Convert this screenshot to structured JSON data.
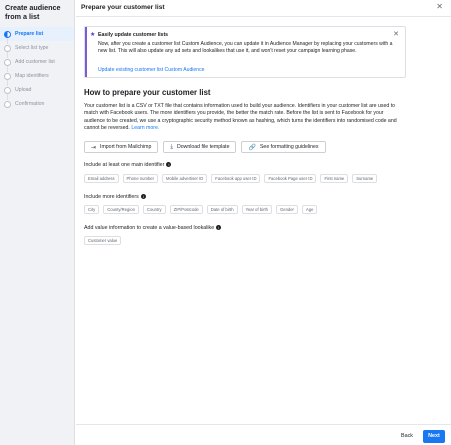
{
  "sidebar": {
    "title": "Create audience from a list",
    "steps": [
      {
        "label": "Prepare list",
        "active": true
      },
      {
        "label": "Select list type",
        "active": false
      },
      {
        "label": "Add customer list",
        "active": false
      },
      {
        "label": "Map identifiers",
        "active": false
      },
      {
        "label": "Upload",
        "active": false
      },
      {
        "label": "Confirmation",
        "active": false
      }
    ]
  },
  "header": {
    "title": "Prepare your customer list",
    "close_glyph": "✕"
  },
  "infobox": {
    "title": "Easily update customer lists",
    "body": "Now, after you create a customer list Custom Audience, you can update it in Audience Manager by replacing your customers with a new list. This will also update any ad sets and lookalikes that use it, and won't reset your campaign learning phase.",
    "link": "Update existing customer list Custom Audience",
    "star_glyph": "★",
    "close_glyph": "✕",
    "accent_color": "#7b5bd6"
  },
  "main": {
    "heading": "How to prepare your customer list",
    "paragraph": "Your customer list is a CSV or TXT file that contains information used to build your audience. Identifiers in your customer list are used to match with Facebook users. The more identifiers you provide, the better the match rate. Before the list is sent to Facebook for your audience to be created, we use a cryptographic security method known as hashing, which turns the identifiers into randomised code and cannot be reversed.",
    "learn_more": "Learn more.",
    "buttons": {
      "import": "Import from Mailchimp",
      "download": "Download file template",
      "guidelines": "See formatting guidelines"
    },
    "main_identifiers": {
      "label": "Include at least one main identifier",
      "chips": [
        "Email address",
        "Phone number",
        "Mobile advertiser ID",
        "Facebook app user ID",
        "Facebook Page user ID",
        "First name",
        "Surname"
      ]
    },
    "more_identifiers": {
      "label": "Include more identifiers",
      "chips": [
        "City",
        "County/Region",
        "Country",
        "ZIP/Postcode",
        "Date of birth",
        "Year of birth",
        "Gender",
        "Age"
      ]
    },
    "value_info": {
      "label": "Add value information to create a value-based lookalike",
      "chips": [
        "Customer value"
      ]
    }
  },
  "footer": {
    "back": "Back",
    "next": "Next",
    "primary_color": "#1877f2"
  }
}
